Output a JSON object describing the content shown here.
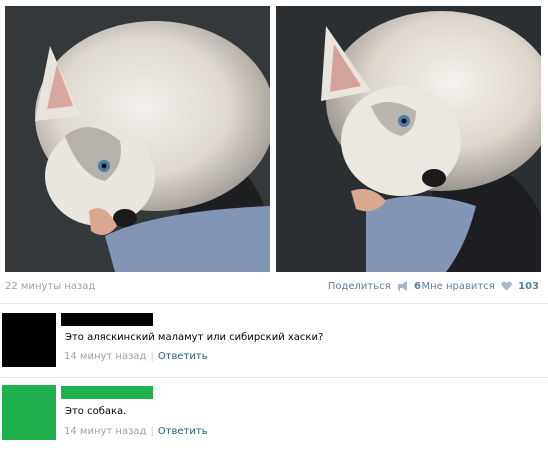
{
  "photos": [
    {
      "subject": "husky puppy photo"
    },
    {
      "subject": "husky puppy photo"
    }
  ],
  "post_meta": {
    "time": "22 минуты назад",
    "share_label": "Поделиться",
    "share_count": "6",
    "like_label": "Мне нравится",
    "like_count": "103"
  },
  "comments": [
    {
      "avatar_color": "#000000",
      "name_color": "#000000",
      "text": "Это аляскинский маламут или сибирский хаски?",
      "date": "14 минут назад",
      "reply_label": "Ответить"
    },
    {
      "avatar_color": "#1fb14d",
      "name_color": "#1fb14d",
      "text": "Это собака.",
      "date": "14 минут назад",
      "reply_label": "Ответить"
    }
  ],
  "colors": {
    "link": "#2a5885",
    "muted": "#99a2ad",
    "icon": "#a8b7c9"
  }
}
